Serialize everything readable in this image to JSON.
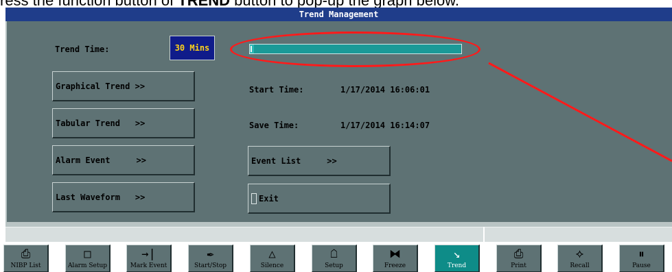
{
  "caption": {
    "prefix": "ress the function button of ",
    "bold": "TREND",
    "suffix": " button to pop-up the graph below."
  },
  "window": {
    "title": "Trend Management"
  },
  "trend_time": {
    "label": "Trend Time:",
    "value": "30 Mins",
    "progress": 0.02
  },
  "buttons": {
    "graphical_trend": "Graphical Trend >>",
    "tabular_trend": "Tabular Trend",
    "tabular_arrow": ">>",
    "alarm_event": "Alarm Event",
    "alarm_arrow": ">>",
    "last_waveform": "Last Waveform",
    "last_arrow": ">>",
    "event_list": "Event List",
    "event_arrow": ">>",
    "exit": "Exit"
  },
  "info": {
    "start_label": "Start Time:",
    "start_value": "1/17/2014  16:06:01",
    "save_label": "Save Time:",
    "save_value": "1/17/2014  16:14:07"
  },
  "function_keys": [
    {
      "label": "NIBP List",
      "icon": "nibp-list-icon",
      "glyph": "⎙"
    },
    {
      "label": "Alarm Setup",
      "icon": "alarm-setup-icon",
      "glyph": "□"
    },
    {
      "label": "Mark Event",
      "icon": "mark-event-icon",
      "glyph": "→|"
    },
    {
      "label": "Start/Stop",
      "icon": "start-stop-icon",
      "glyph": "✒"
    },
    {
      "label": "Silence",
      "icon": "silence-icon",
      "glyph": "△"
    },
    {
      "label": "Setup",
      "icon": "setup-icon",
      "glyph": "☖"
    },
    {
      "label": "Freeze",
      "icon": "freeze-icon",
      "glyph": "⧓"
    },
    {
      "label": "Trend",
      "icon": "trend-icon",
      "glyph": "↘"
    },
    {
      "label": "Print",
      "icon": "print-icon",
      "glyph": "⎙"
    },
    {
      "label": "Recall",
      "icon": "recall-icon",
      "glyph": "⟡"
    },
    {
      "label": "Pause",
      "icon": "pause-icon",
      "glyph": "⏸"
    }
  ],
  "colors": {
    "panel": "#5e7274",
    "title_bar": "#1f3d8a",
    "time_box": "#101c8a",
    "time_text": "#ffd21a",
    "progress": "#1a9a98",
    "active_key": "#0e8c88",
    "annotation": "#ff1a1a"
  }
}
